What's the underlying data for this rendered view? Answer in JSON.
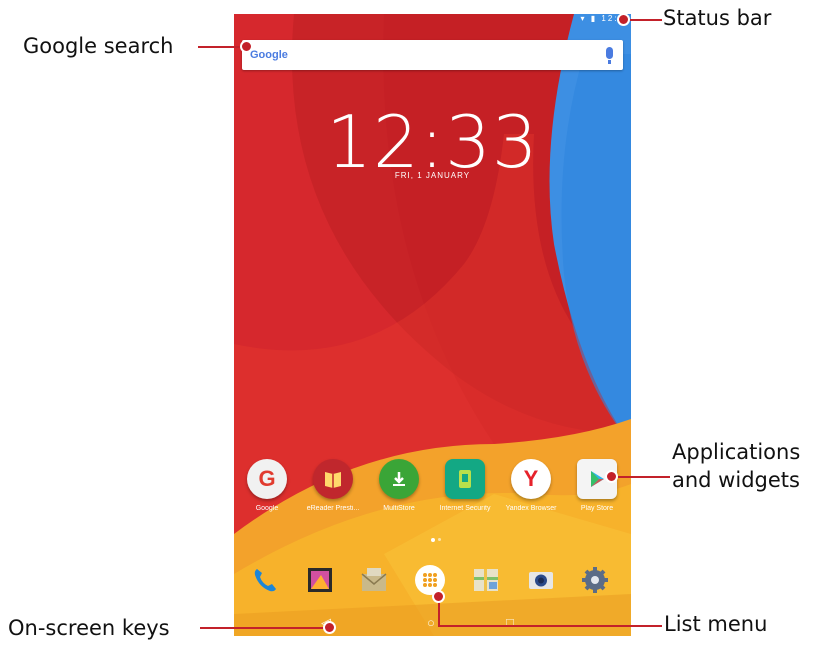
{
  "annotations": {
    "google_search": "Google search",
    "status_bar": "Status bar",
    "applications_widgets": "Applications and widgets",
    "on_screen_keys": "On-screen keys",
    "list_menu": "List menu"
  },
  "status_bar": {
    "time": "12:3"
  },
  "search": {
    "logo_text": "Google"
  },
  "lock": {
    "time": "12:33",
    "date": "FRI, 1 JANUARY"
  },
  "apps": [
    {
      "label": "Google",
      "icon": "google-icon",
      "color": "#f1f1f1"
    },
    {
      "label": "eReader Presti...",
      "icon": "ereader-icon",
      "color": "#c0272d"
    },
    {
      "label": "MultiStore",
      "icon": "multistore-icon",
      "color": "#3aa537"
    },
    {
      "label": "Internet Security",
      "icon": "internet-security-icon",
      "color": "#13a884"
    },
    {
      "label": "Yandex Browser",
      "icon": "yandex-browser-icon",
      "color": "#ffffff"
    },
    {
      "label": "Play Store",
      "icon": "play-store-icon",
      "color": "#f4f4f4"
    }
  ],
  "dock": [
    {
      "icon": "phone-icon"
    },
    {
      "icon": "gallery-icon"
    },
    {
      "icon": "email-icon"
    },
    {
      "icon": "app-drawer-icon"
    },
    {
      "icon": "maps-icon"
    },
    {
      "icon": "camera-icon"
    },
    {
      "icon": "settings-icon"
    }
  ],
  "navbar": {
    "back": "◁",
    "home": "○",
    "recents": "□"
  },
  "colors": {
    "accent_red": "#c3212a",
    "wallpaper_red": "#d82a2e",
    "wallpaper_orange": "#f0a020",
    "wallpaper_blue": "#3c8fe0"
  }
}
